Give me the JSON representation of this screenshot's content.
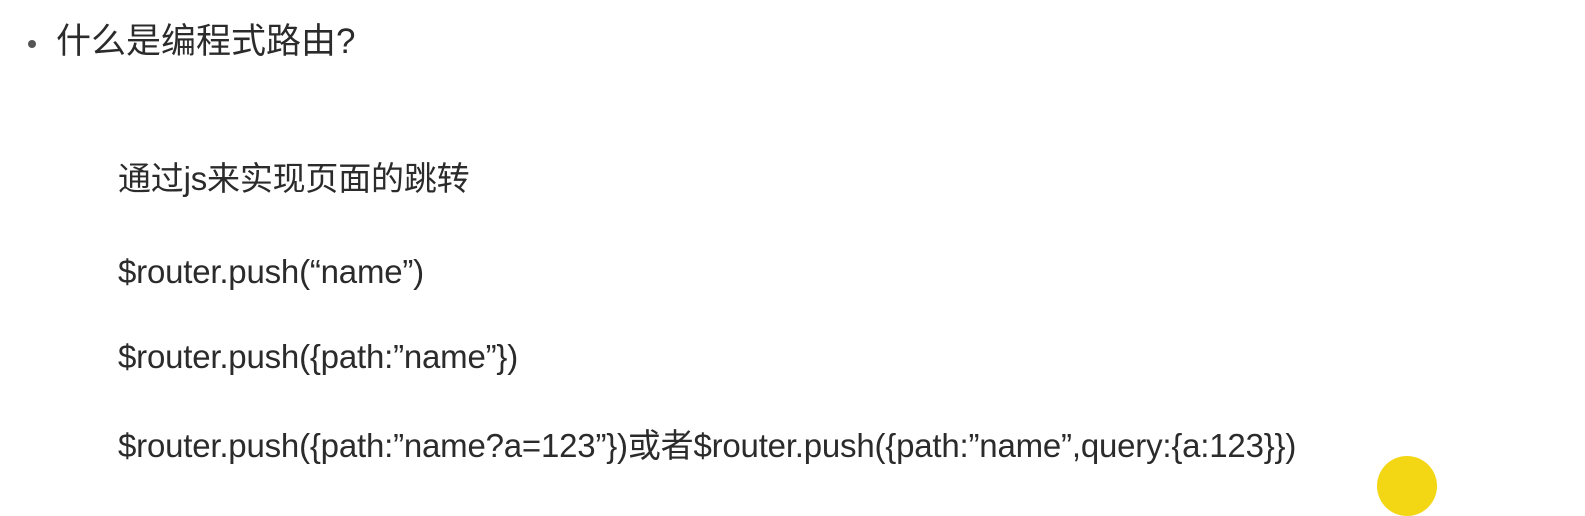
{
  "slide": {
    "heading": "什么是编程式路由?",
    "lines": [
      "通过js来实现页面的跳转",
      "$router.push(“name”)",
      "$router.push({path:”name”})",
      "$router.push({path:”name?a=123”})或者$router.push({path:”name”,query:{a:123}})"
    ],
    "cursor_color": "#f2d200"
  }
}
